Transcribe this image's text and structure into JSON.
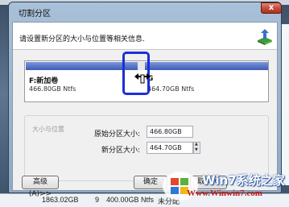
{
  "dialog": {
    "title": "切割分区",
    "close_label": "x",
    "description": "请设置新分区的大小与位置等相关信息."
  },
  "partitions": {
    "left": {
      "name": "F:新加卷",
      "size": "466.80GB Ntfs"
    },
    "right": {
      "name": "G",
      "size": "464.70GB Ntfs"
    }
  },
  "size_position": {
    "group_title": "大小与位置",
    "original_label": "原始分区大小:",
    "original_value": "466.80GB",
    "new_label": "新分区大小:",
    "new_value": "464.70GB"
  },
  "buttons": {
    "advanced": "高级(A)>>",
    "ok": "确定",
    "cancel_prefix": "取消(C"
  },
  "background": {
    "cells": [
      "1863.02GB",
      "9",
      "400.00GB Ntfs",
      "未分配"
    ]
  },
  "watermark": {
    "brand": "Win7系统之家",
    "url": "Www.Winwin7.com"
  },
  "colors": {
    "partition_fill": "#3c5bb7",
    "highlight": "#1c2fd6",
    "watermark_red": "#c21c17"
  },
  "icons": [
    "close-icon",
    "partition-wizard-icon",
    "resize-arrow-icon",
    "spin-icon",
    "win7-logo-icon"
  ]
}
